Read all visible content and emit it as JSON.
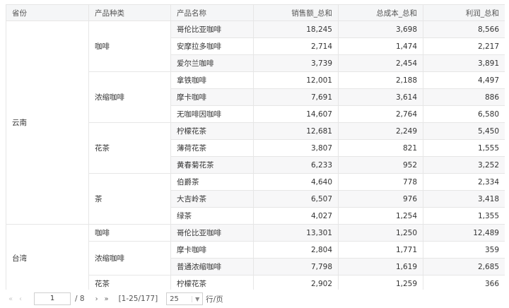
{
  "columns": [
    "省份",
    "产品种类",
    "产品名称",
    "销售额_总和",
    "总成本_总和",
    "利润_总和"
  ],
  "provinces": [
    {
      "name": "云南",
      "categories": [
        {
          "name": "咖啡",
          "rows": [
            {
              "product": "哥伦比亚咖啡",
              "sales": "18,245",
              "cost": "3,698",
              "profit": "8,566"
            },
            {
              "product": "安摩拉多咖啡",
              "sales": "2,714",
              "cost": "1,474",
              "profit": "2,217"
            },
            {
              "product": "爱尔兰咖啡",
              "sales": "3,739",
              "cost": "2,454",
              "profit": "3,891"
            }
          ]
        },
        {
          "name": "浓缩咖啡",
          "rows": [
            {
              "product": "拿铁咖啡",
              "sales": "12,001",
              "cost": "2,188",
              "profit": "4,497"
            },
            {
              "product": "摩卡咖啡",
              "sales": "7,691",
              "cost": "3,614",
              "profit": "886"
            },
            {
              "product": "无咖啡因咖啡",
              "sales": "14,607",
              "cost": "2,764",
              "profit": "6,580"
            }
          ]
        },
        {
          "name": "花茶",
          "rows": [
            {
              "product": "柠檬花茶",
              "sales": "12,681",
              "cost": "2,249",
              "profit": "5,450"
            },
            {
              "product": "薄荷花茶",
              "sales": "3,807",
              "cost": "821",
              "profit": "1,555"
            },
            {
              "product": "黄春菊花茶",
              "sales": "6,233",
              "cost": "952",
              "profit": "3,252"
            }
          ]
        },
        {
          "name": "茶",
          "rows": [
            {
              "product": "伯爵茶",
              "sales": "4,640",
              "cost": "778",
              "profit": "2,334"
            },
            {
              "product": "大吉岭茶",
              "sales": "6,507",
              "cost": "976",
              "profit": "3,418"
            },
            {
              "product": "绿茶",
              "sales": "4,027",
              "cost": "1,254",
              "profit": "1,355"
            }
          ]
        }
      ]
    },
    {
      "name": "台湾",
      "categories": [
        {
          "name": "咖啡",
          "rows": [
            {
              "product": "哥伦比亚咖啡",
              "sales": "13,301",
              "cost": "1,250",
              "profit": "12,489"
            }
          ]
        },
        {
          "name": "浓缩咖啡",
          "rows": [
            {
              "product": "摩卡咖啡",
              "sales": "2,804",
              "cost": "1,771",
              "profit": "359"
            },
            {
              "product": "普通浓缩咖啡",
              "sales": "7,798",
              "cost": "1,619",
              "profit": "2,685"
            }
          ]
        },
        {
          "name": "花茶",
          "rows": [
            {
              "product": "柠檬花茶",
              "sales": "2,902",
              "cost": "1,259",
              "profit": "366"
            }
          ]
        }
      ]
    }
  ],
  "pager": {
    "first": "«",
    "prev": "‹",
    "page": "1",
    "sep": "/ 8",
    "next": "›",
    "last": "»",
    "range": "[1-25/177]",
    "page_size": "25",
    "per_page": "行/页"
  }
}
